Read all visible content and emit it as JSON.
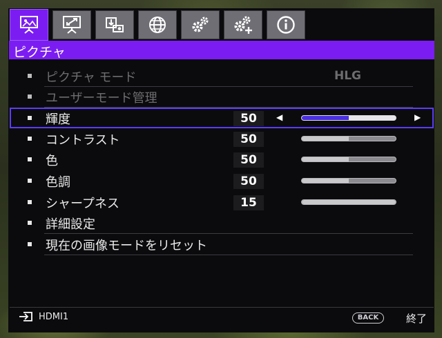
{
  "tabs": [
    {
      "icon": "picture-icon",
      "active": true
    },
    {
      "icon": "display-icon",
      "active": false
    },
    {
      "icon": "installation-icon",
      "active": false
    },
    {
      "icon": "globe-icon",
      "active": false
    },
    {
      "icon": "settings-icon",
      "active": false
    },
    {
      "icon": "advanced-settings-icon",
      "active": false
    },
    {
      "icon": "info-icon",
      "active": false
    }
  ],
  "menu": {
    "title": "ピクチャ",
    "items": [
      {
        "label": "ピクチャ モード",
        "value": "HLG"
      },
      {
        "label": "ユーザーモード管理"
      },
      {
        "label": "輝度",
        "value": "50",
        "left_arrow": "◀",
        "right_arrow": "▶"
      },
      {
        "label": "コントラスト",
        "value": "50"
      },
      {
        "label": "色",
        "value": "50"
      },
      {
        "label": "色調",
        "value": "50"
      },
      {
        "label": "シャープネス",
        "value": "15"
      },
      {
        "label": "詳細設定"
      },
      {
        "label": "現在の画像モードをリセット"
      }
    ]
  },
  "slider_levels": {
    "brightness": 0.5,
    "contrast": 0.5,
    "color": 0.5,
    "tint": 0.5,
    "sharpness": 1.0
  },
  "footer": {
    "source": "HDMI1",
    "back_label": "BACK",
    "exit_label": "終了"
  },
  "colors": {
    "accent": "#7b1df2",
    "selection_border": "#5b3df5",
    "slider_fill_active": "#4a2fe0"
  }
}
